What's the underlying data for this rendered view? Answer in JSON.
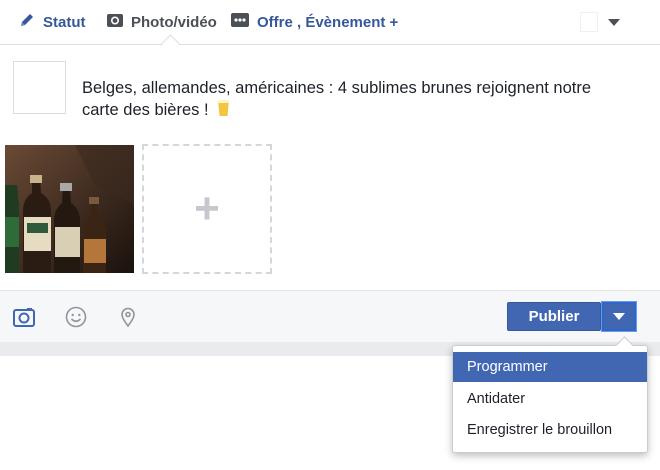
{
  "tabs": [
    {
      "label": "Statut",
      "icon": "pencil-icon"
    },
    {
      "label": "Photo/vidéo",
      "icon": "camera-icon"
    },
    {
      "label": "Offre , Évènement +",
      "icon": "offer-icon"
    }
  ],
  "audience": {
    "icon": "chevron-down-icon"
  },
  "post": {
    "text": "Belges, allemandes, américaines : 4 sublimes brunes rejoignent notre carte des bières !",
    "emoji": "beer-glass-icon"
  },
  "media": {
    "add_label": "+"
  },
  "bottom": {
    "icons": [
      "camera-icon",
      "smiley-icon",
      "location-pin-icon"
    ],
    "publish_label": "Publier"
  },
  "menu": {
    "items": [
      "Programmer",
      "Antidater",
      "Enregistrer le brouillon"
    ],
    "selected_index": 0
  },
  "colors": {
    "accent": "#4267b2",
    "link": "#365899",
    "border": "#dddfe2"
  }
}
